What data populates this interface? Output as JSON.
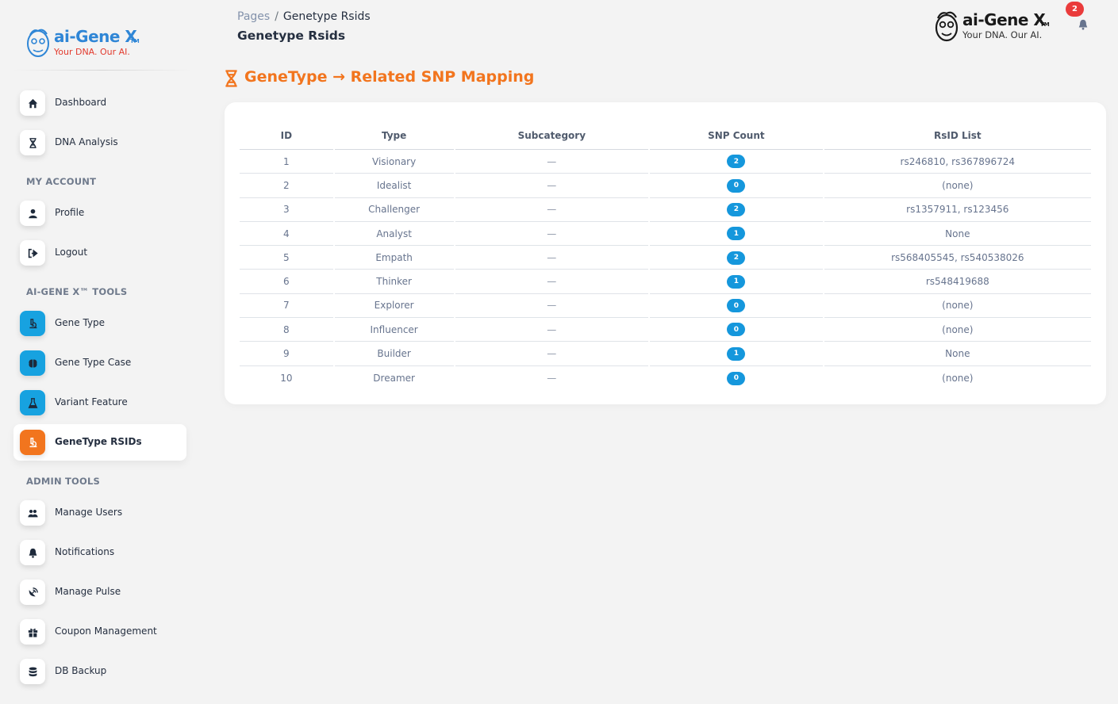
{
  "brand": {
    "name": "ai-Gene X",
    "tm": "TM",
    "tagline": "Your DNA. Our AI."
  },
  "sidebar": {
    "items_top": [
      {
        "label": "Dashboard",
        "icon": "home-icon"
      },
      {
        "label": "DNA Analysis",
        "icon": "dna-icon"
      }
    ],
    "section_account": "MY ACCOUNT",
    "items_account": [
      {
        "label": "Profile",
        "icon": "user-icon"
      },
      {
        "label": "Logout",
        "icon": "logout-icon"
      }
    ],
    "section_tools": "AI-GENE X™ TOOLS",
    "items_tools": [
      {
        "label": "Gene Type",
        "icon": "microscope-icon"
      },
      {
        "label": "Gene Type Case",
        "icon": "brain-icon"
      },
      {
        "label": "Variant Feature",
        "icon": "flask-icon"
      },
      {
        "label": "GeneType RSIDs",
        "icon": "microscope-icon",
        "active": true
      }
    ],
    "section_admin": "ADMIN TOOLS",
    "items_admin": [
      {
        "label": "Manage Users",
        "icon": "users-icon"
      },
      {
        "label": "Notifications",
        "icon": "bell-icon"
      },
      {
        "label": "Manage Pulse",
        "icon": "satellite-dish-icon"
      },
      {
        "label": "Coupon Management",
        "icon": "gift-icon"
      },
      {
        "label": "DB Backup",
        "icon": "database-icon"
      }
    ]
  },
  "header": {
    "breadcrumb_root": "Pages",
    "breadcrumb_sep": "/",
    "breadcrumb_current": "Genetype Rsids",
    "page_title": "Genetype Rsids",
    "notification_count": "2"
  },
  "section": {
    "title": "GeneType → Related SNP Mapping"
  },
  "table": {
    "columns": [
      "ID",
      "Type",
      "Subcategory",
      "SNP Count",
      "RsID List"
    ],
    "rows": [
      {
        "id": "1",
        "type": "Visionary",
        "subcategory": "—",
        "snp_count": "2",
        "rsids": "rs246810, rs367896724"
      },
      {
        "id": "2",
        "type": "Idealist",
        "subcategory": "—",
        "snp_count": "0",
        "rsids": "(none)"
      },
      {
        "id": "3",
        "type": "Challenger",
        "subcategory": "—",
        "snp_count": "2",
        "rsids": "rs1357911, rs123456"
      },
      {
        "id": "4",
        "type": "Analyst",
        "subcategory": "—",
        "snp_count": "1",
        "rsids": "None"
      },
      {
        "id": "5",
        "type": "Empath",
        "subcategory": "—",
        "snp_count": "2",
        "rsids": "rs568405545, rs540538026"
      },
      {
        "id": "6",
        "type": "Thinker",
        "subcategory": "—",
        "snp_count": "1",
        "rsids": "rs548419688"
      },
      {
        "id": "7",
        "type": "Explorer",
        "subcategory": "—",
        "snp_count": "0",
        "rsids": "(none)"
      },
      {
        "id": "8",
        "type": "Influencer",
        "subcategory": "—",
        "snp_count": "0",
        "rsids": "(none)"
      },
      {
        "id": "9",
        "type": "Builder",
        "subcategory": "—",
        "snp_count": "1",
        "rsids": "None"
      },
      {
        "id": "10",
        "type": "Dreamer",
        "subcategory": "—",
        "snp_count": "0",
        "rsids": "(none)"
      }
    ]
  },
  "colors": {
    "accent": "#f2751e",
    "badge": "#1597dc",
    "tool_icon": "#17a2e0",
    "notification": "#ea3b3b"
  }
}
